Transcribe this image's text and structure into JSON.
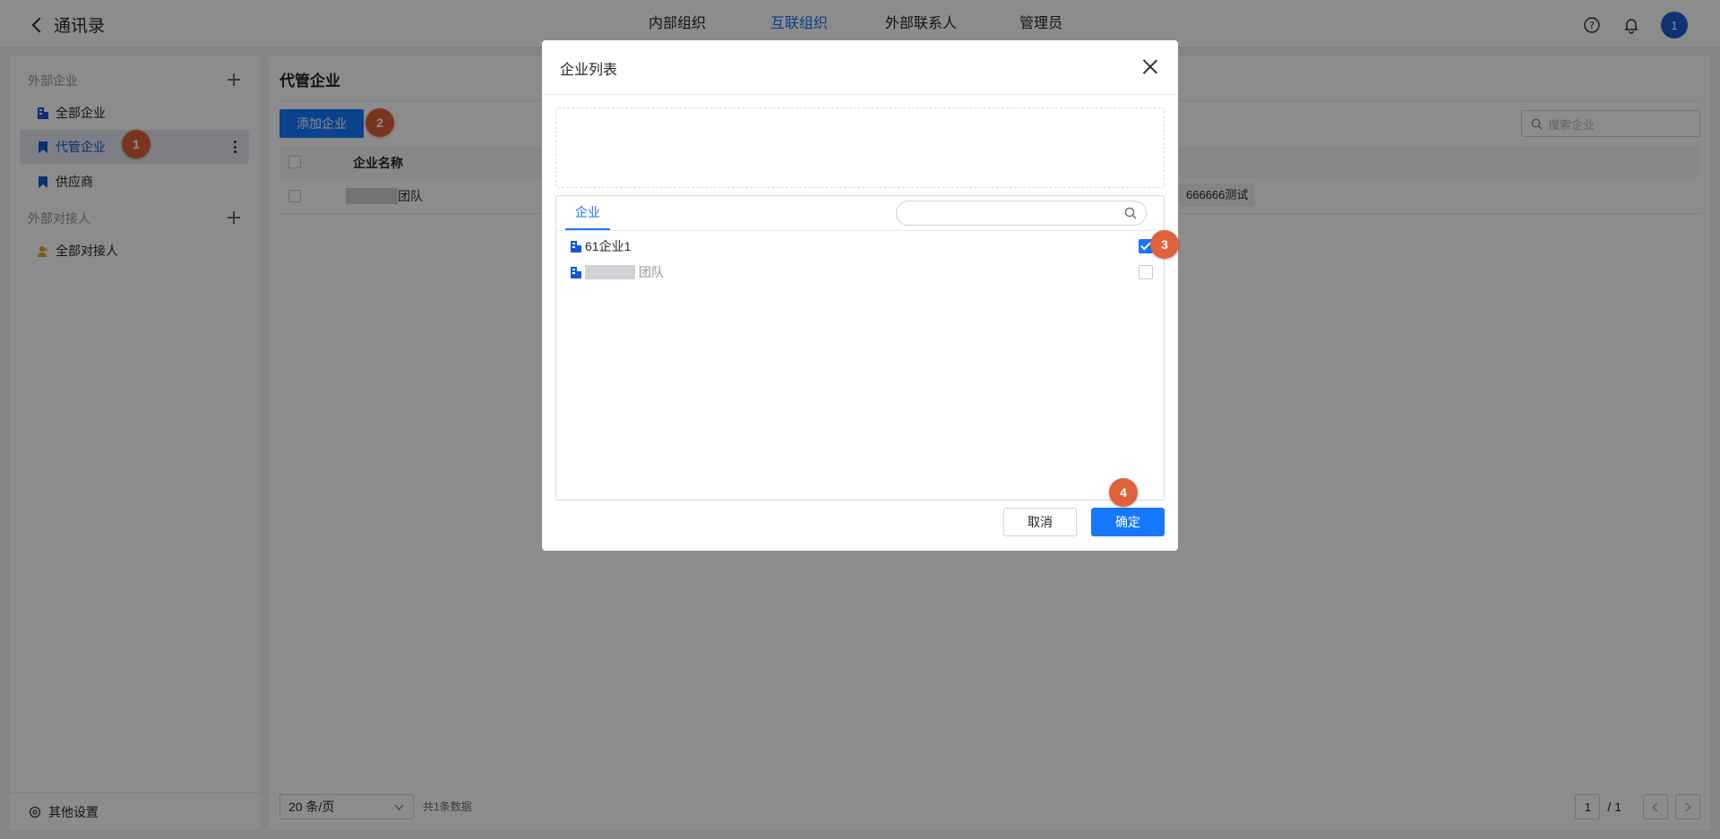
{
  "header": {
    "back_label": "通讯录",
    "tabs": [
      {
        "label": "内部组织",
        "active": false
      },
      {
        "label": "互联组织",
        "active": true
      },
      {
        "label": "外部联系人",
        "active": false
      },
      {
        "label": "管理员",
        "active": false
      }
    ],
    "avatar_text": "1"
  },
  "sidebar": {
    "section_external_companies": "外部企业",
    "items_companies": [
      {
        "label": "全部企业",
        "icon": "building-icon"
      },
      {
        "label": "代管企业",
        "icon": "bookmark-icon",
        "active": true
      },
      {
        "label": "供应商",
        "icon": "bookmark-icon"
      }
    ],
    "section_external_contacts": "外部对接人",
    "items_contacts": [
      {
        "label": "全部对接人",
        "icon": "people-icon"
      }
    ],
    "bottom_label": "其他设置"
  },
  "main": {
    "title": "代管企业",
    "add_button": "添加企业",
    "search_placeholder": "搜索企业",
    "table": {
      "col_name": "企业名称",
      "rows": [
        {
          "name_suffix": "团队",
          "tag": "666666测试"
        }
      ]
    },
    "pager": {
      "page_size": "20 条/页",
      "total": "共1条数据",
      "current": "1",
      "pages": "/ 1"
    }
  },
  "modal": {
    "title": "企业列表",
    "tab_label": "企业",
    "search_placeholder": "",
    "items": [
      {
        "label": "61企业1",
        "checked": true
      },
      {
        "label_suffix": "团队",
        "checked": false
      }
    ],
    "cancel_label": "取消",
    "ok_label": "确定"
  },
  "steps": [
    "1",
    "2",
    "3",
    "4"
  ],
  "colors": {
    "accent": "#1677ff",
    "step_marker": "#e0623a",
    "overlay": "rgba(0,0,0,0.45)"
  }
}
